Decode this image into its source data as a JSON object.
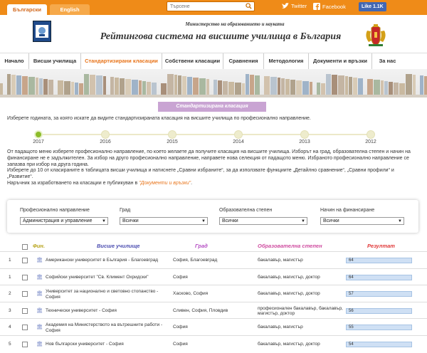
{
  "topbar": {
    "lang_bg": "Български",
    "lang_en": "English",
    "search_placeholder": "Търсене",
    "twitter": "Twitter",
    "facebook": "Facebook",
    "like": "Like 1.1K"
  },
  "header": {
    "ministry": "Министерство на образованието и науката",
    "title": "Рейтингова система на висшите училища в България"
  },
  "nav": [
    "Начало",
    "Висши училища",
    "Стандартизирани класации",
    "Собствени класации",
    "Сравнения",
    "Методология",
    "Документи и връзки",
    "За нас"
  ],
  "section_title": "Стандартизирана класация",
  "instruction": "Изберете годината, за която искате да видите стандартизираната класация на висшите училища по професионално направление.",
  "timeline": [
    "2017",
    "2016",
    "2015",
    "2014",
    "2013",
    "2012"
  ],
  "description": {
    "line1": "От падащото меню изберете професионално направление, по което желаете да получите класация на висшите училища. Изборът на град, образователна степен и начин на",
    "line2": "финансиране не е задължителен. За избор на друго професионално направление, направете нова селекция от падащото меню. Избраното професионално направление се",
    "line3": "запазва при избор на друга година.",
    "line4": "Изберете до 10 от класираните в таблицата висши училища и натиснете „Сравни избраните“, за да използвате функциите „Детайлно сравнение“, „Сравни профили“ и",
    "line5": "„Развитие“.",
    "line6_pre": "Наръчник за изработването на класации е публикуван в ",
    "line6_link": "\"Документи и връзки\"",
    "line6_post": "."
  },
  "filters": {
    "field_label": "Професионално направление",
    "field_value": "Администрация и управление",
    "city_label": "Град",
    "city_value": "Всички",
    "degree_label": "Образователна степен",
    "degree_value": "Всички",
    "funding_label": "Начин на финансиране",
    "funding_value": "Всички"
  },
  "table": {
    "headers": {
      "fin": "Фин.",
      "university": "Висше училище",
      "city": "Град",
      "degree": "Образователна степен",
      "result": "Резултат"
    },
    "rows": [
      {
        "rank": "1",
        "name": "Американски университет в България - Благоевград",
        "city": "София, Благоевград",
        "degree": "бакалавър, магистър",
        "score": "64"
      },
      {
        "rank": "1",
        "name": "Софийски университет \"Св. Климент Охридски\"",
        "city": "София",
        "degree": "бакалавър, магистър, доктор",
        "score": "64"
      },
      {
        "rank": "2",
        "name": "Университет за национално и световно стопанство - София",
        "city": "Хасково, София",
        "degree": "бакалавър, магистър, доктор",
        "score": "57"
      },
      {
        "rank": "3",
        "name": "Технически университет - София",
        "city": "Сливен, София, Пловдив",
        "degree": "професионален бакалавър, бакалавър, магистър, доктор",
        "score": "56"
      },
      {
        "rank": "4",
        "name": "Академия на Министерството на вътрешните работи - София",
        "city": "София",
        "degree": "бакалавър, магистър",
        "score": "55"
      },
      {
        "rank": "5",
        "name": "Нов български университет - София",
        "city": "София",
        "degree": "бакалавър, магистър, доктор",
        "score": "54"
      }
    ]
  },
  "colors": {
    "brand_orange": "#ef8b18",
    "nav_active": "#e8741a",
    "header_university": "#4b4db0",
    "header_city": "#b44cc3",
    "header_degree": "#cf4da0",
    "header_result": "#e13a3a",
    "header_fin": "#b8a51e",
    "timeline_active": "#8cbc2a"
  }
}
